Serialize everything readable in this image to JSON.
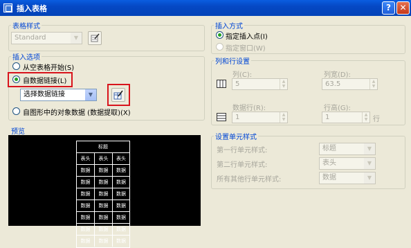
{
  "window": {
    "title": "插入表格",
    "help_label": "?",
    "close_label": "✕"
  },
  "table_style": {
    "legend": "表格样式",
    "selected": "Standard"
  },
  "insert_options": {
    "legend": "插入选项",
    "from_empty": "从空表格开始(S)",
    "from_data_link": "自数据链接(L)",
    "data_link_select": "选择数据链接",
    "from_object_data": "自图形中的对象数据 (数据提取)(X)"
  },
  "preview": {
    "legend": "预览",
    "title_cell": "标题",
    "headers": [
      "表头",
      "表头",
      "表头"
    ],
    "data_cell": "数据",
    "data_row_count": 7
  },
  "insert_method": {
    "legend": "插入方式",
    "specify_point": "指定插入点(I)",
    "specify_window": "指定窗口(W)"
  },
  "rows_cols": {
    "legend": "列和行设置",
    "columns_label": "列(C):",
    "columns_value": "5",
    "col_width_label": "列宽(D):",
    "col_width_value": "63.5",
    "data_rows_label": "数据行(R):",
    "data_rows_value": "1",
    "row_height_label": "行高(G):",
    "row_height_value": "1",
    "row_unit": "行"
  },
  "cell_styles": {
    "legend": "设置单元样式",
    "first_row_label": "第一行单元样式:",
    "first_row_value": "标题",
    "second_row_label": "第二行单元样式:",
    "second_row_value": "表头",
    "other_rows_label": "所有其他行单元样式:",
    "other_rows_value": "数据"
  },
  "colors": {
    "title_bar": "#0548c4",
    "highlight": "#d8141c",
    "legend_text": "#0046d5"
  }
}
